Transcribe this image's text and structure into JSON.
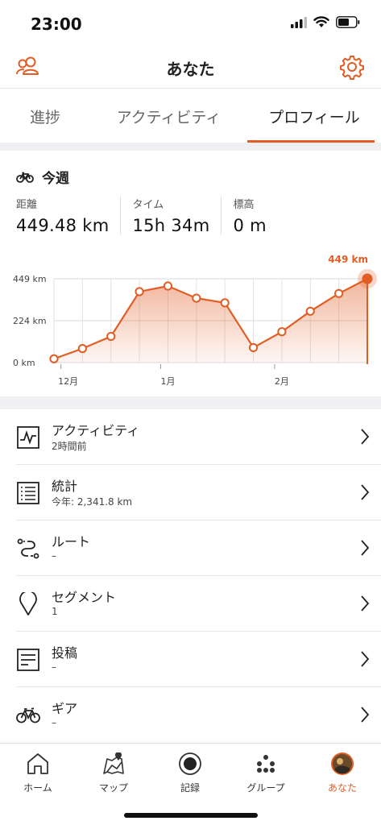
{
  "status": {
    "time": "23:00"
  },
  "header": {
    "title": "あなた"
  },
  "tabs": [
    {
      "label": "進捗",
      "active": false
    },
    {
      "label": "アクティビティ",
      "active": false
    },
    {
      "label": "プロフィール",
      "active": true
    }
  ],
  "week": {
    "title": "今週",
    "stats": [
      {
        "label": "距離",
        "value": "449.48 km"
      },
      {
        "label": "タイム",
        "value": "15h 34m"
      },
      {
        "label": "標高",
        "value": "0 m"
      }
    ]
  },
  "chart_data": {
    "type": "area",
    "y_ticks": [
      "449 km",
      "224 km",
      "0 km"
    ],
    "ylim": [
      0,
      449
    ],
    "x_labels": [
      {
        "label": "12月",
        "index": 0.5
      },
      {
        "label": "1月",
        "index": 4.0
      },
      {
        "label": "2月",
        "index": 8.0
      }
    ],
    "values": [
      20,
      75,
      140,
      380,
      410,
      345,
      320,
      80,
      165,
      275,
      370,
      449
    ],
    "highlight_label": "449 km",
    "accent": "#e25d24",
    "grid": true
  },
  "menu": [
    {
      "title": "アクティビティ",
      "sub": "2時間前",
      "icon": "activity-chart-icon"
    },
    {
      "title": "統計",
      "sub": "今年: 2,341.8 km",
      "icon": "stats-list-icon"
    },
    {
      "title": "ルート",
      "sub": "–",
      "icon": "route-icon"
    },
    {
      "title": "セグメント",
      "sub": "1",
      "icon": "location-pin-icon"
    },
    {
      "title": "投稿",
      "sub": "–",
      "icon": "post-icon"
    },
    {
      "title": "ギア",
      "sub": "–",
      "icon": "bike-icon"
    }
  ],
  "tabbar": [
    {
      "label": "ホーム",
      "icon": "home-icon"
    },
    {
      "label": "マップ",
      "icon": "map-icon"
    },
    {
      "label": "記録",
      "icon": "record-icon"
    },
    {
      "label": "グループ",
      "icon": "groups-icon"
    },
    {
      "label": "あなた",
      "icon": "avatar",
      "active": true
    }
  ],
  "colors": {
    "accent": "#e25d24",
    "divider": "#e6e6e6"
  }
}
